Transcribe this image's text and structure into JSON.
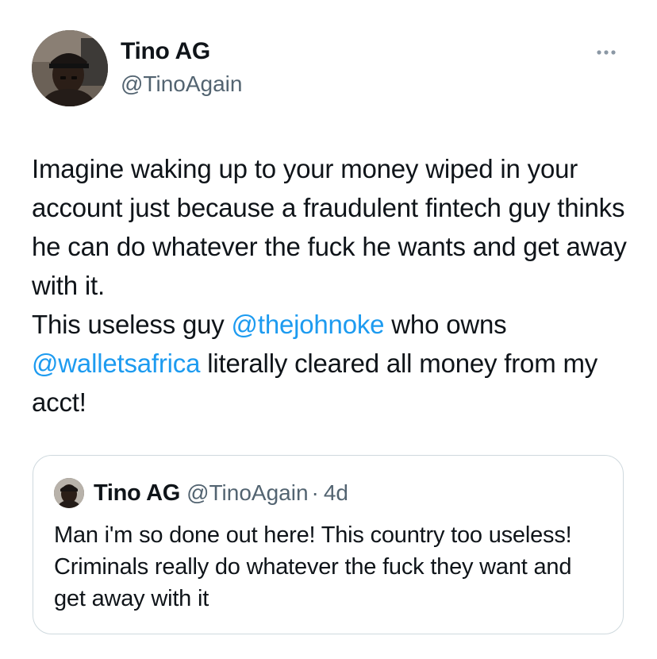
{
  "colors": {
    "text": "#0f1419",
    "secondary": "#536471",
    "link": "#1d9bf0",
    "border": "#cfd9de"
  },
  "author": {
    "display_name": "Tino AG",
    "handle": "@TinoAgain",
    "avatar_icon": "user-photo-avatar"
  },
  "more_icon": "more-options-ellipsis-icon",
  "tweet": {
    "segments": [
      {
        "type": "text",
        "text": "Imagine waking up to your money wiped in your account just because a fraudulent fintech guy thinks he can do whatever the fuck he wants and get away with it.\nThis useless guy "
      },
      {
        "type": "mention",
        "text": "@thejohnoke"
      },
      {
        "type": "text",
        "text": " who owns "
      },
      {
        "type": "mention",
        "text": "@walletsafrica"
      },
      {
        "type": "text",
        "text": " literally cleared all money from my acct!"
      }
    ]
  },
  "quote": {
    "display_name": "Tino AG",
    "handle": "@TinoAgain",
    "separator": "·",
    "time": "4d",
    "text": "Man i'm so done out here! This country too useless! Criminals really do whatever the fuck they want and get away with it"
  }
}
